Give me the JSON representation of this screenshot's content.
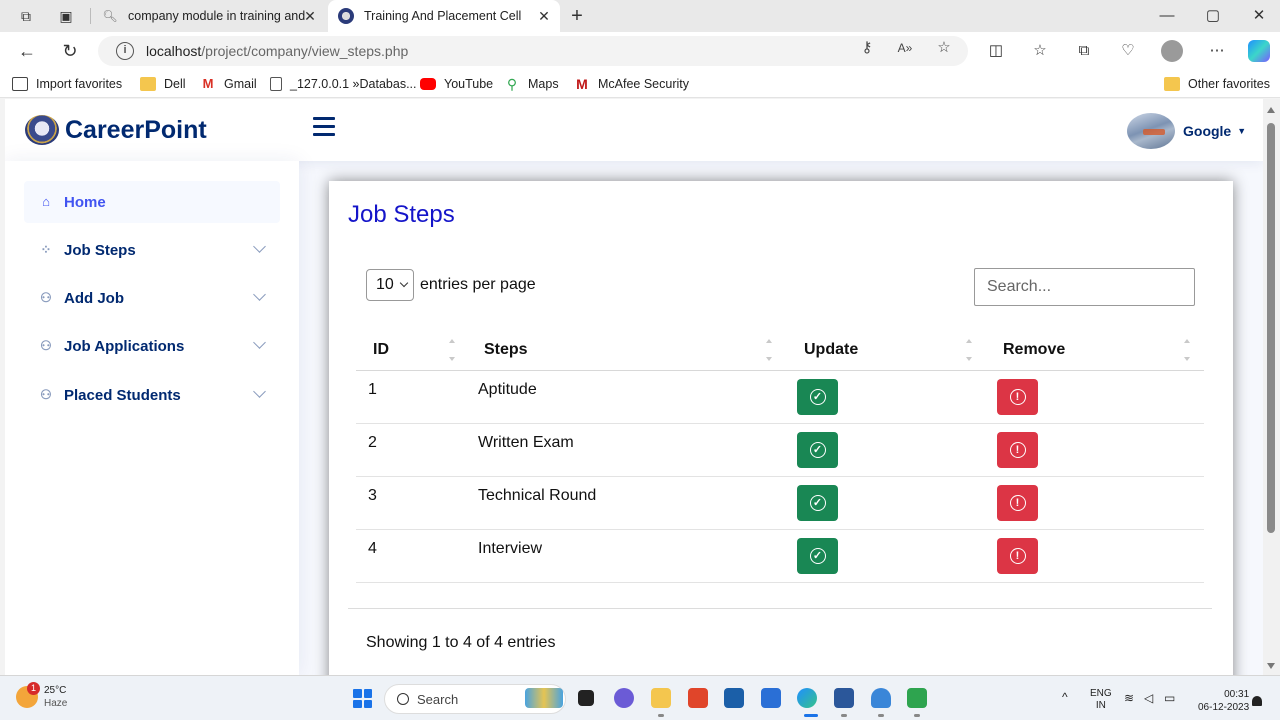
{
  "browser": {
    "tabs": [
      {
        "title": "company module in training and"
      },
      {
        "title": "Training And Placement Cell"
      }
    ],
    "url_host": "localhost",
    "url_path": "/project/company/view_steps.php",
    "favorites": [
      {
        "label": "Import favorites",
        "icon": "import-icon"
      },
      {
        "label": "Dell",
        "icon": "folder-icon"
      },
      {
        "label": "Gmail",
        "icon": "gmail-icon"
      },
      {
        "label": "_127.0.0.1 »Databas...",
        "icon": "page-icon"
      },
      {
        "label": "YouTube",
        "icon": "youtube-icon"
      },
      {
        "label": "Maps",
        "icon": "maps-icon"
      },
      {
        "label": "McAfee Security",
        "icon": "mcafee-icon"
      }
    ],
    "other_favorites": "Other favorites"
  },
  "header": {
    "brand": "CareerPoint",
    "user_name": "Google"
  },
  "sidebar": {
    "items": [
      {
        "label": "Home",
        "icon": "home-icon"
      },
      {
        "label": "Job Steps",
        "icon": "grid-icon"
      },
      {
        "label": "Add Job",
        "icon": "people-icon"
      },
      {
        "label": "Job Applications",
        "icon": "people-icon"
      },
      {
        "label": "Placed Students",
        "icon": "people-icon"
      }
    ]
  },
  "main": {
    "title": "Job Steps",
    "page_size": "10",
    "entries_label": "entries per page",
    "search_placeholder": "Search...",
    "columns": [
      "ID",
      "Steps",
      "Update",
      "Remove"
    ],
    "rows": [
      {
        "id": "1",
        "step": "Aptitude"
      },
      {
        "id": "2",
        "step": "Written Exam"
      },
      {
        "id": "3",
        "step": "Technical Round"
      },
      {
        "id": "4",
        "step": "Interview"
      }
    ],
    "footer": "Showing 1 to 4 of 4 entries"
  },
  "colors": {
    "brand": "#012970",
    "title": "#1515c9",
    "update": "#198754",
    "remove": "#dc3545"
  },
  "taskbar": {
    "temperature": "25°C",
    "condition": "Haze",
    "notification_count": "1",
    "search_label": "Search",
    "lang_top": "ENG",
    "lang_bottom": "IN",
    "time": "00:31",
    "date": "06-12-2023"
  }
}
